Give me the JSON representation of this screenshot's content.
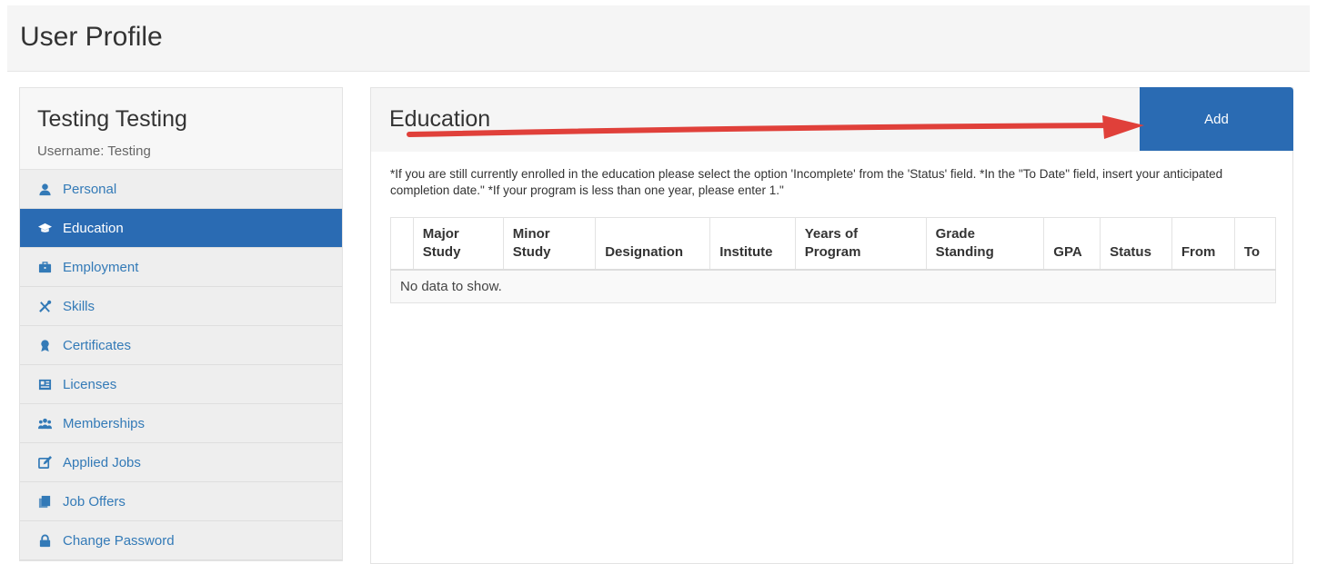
{
  "page": {
    "title": "User Profile"
  },
  "profile": {
    "name": "Testing Testing",
    "username": "Username: Testing"
  },
  "sidebar": {
    "items": [
      {
        "label": "Personal",
        "icon": "user-icon"
      },
      {
        "label": "Education",
        "icon": "graduation-cap-icon",
        "active": true
      },
      {
        "label": "Employment",
        "icon": "briefcase-icon"
      },
      {
        "label": "Skills",
        "icon": "tools-icon"
      },
      {
        "label": "Certificates",
        "icon": "certificate-icon"
      },
      {
        "label": "Licenses",
        "icon": "license-icon"
      },
      {
        "label": "Memberships",
        "icon": "users-icon"
      },
      {
        "label": "Applied Jobs",
        "icon": "edit-icon"
      },
      {
        "label": "Job Offers",
        "icon": "copy-icon"
      },
      {
        "label": "Change Password",
        "icon": "lock-icon"
      }
    ]
  },
  "education": {
    "title": "Education",
    "add_label": "Add",
    "notice": "*If you are still currently enrolled in the education please select the option 'Incomplete' from the 'Status' field. *In the \"To Date\" field, insert your anticipated completion date.\" *If your program is less than one year, please enter 1.\"",
    "columns": [
      "",
      "Major Study",
      "Minor Study",
      "Designation",
      "Institute",
      "Years of Program",
      "Grade Standing",
      "GPA",
      "Status",
      "From",
      "To"
    ],
    "empty_text": "No data to show."
  },
  "colors": {
    "accent": "#2a6bb3",
    "arrow": "#e0403a"
  }
}
